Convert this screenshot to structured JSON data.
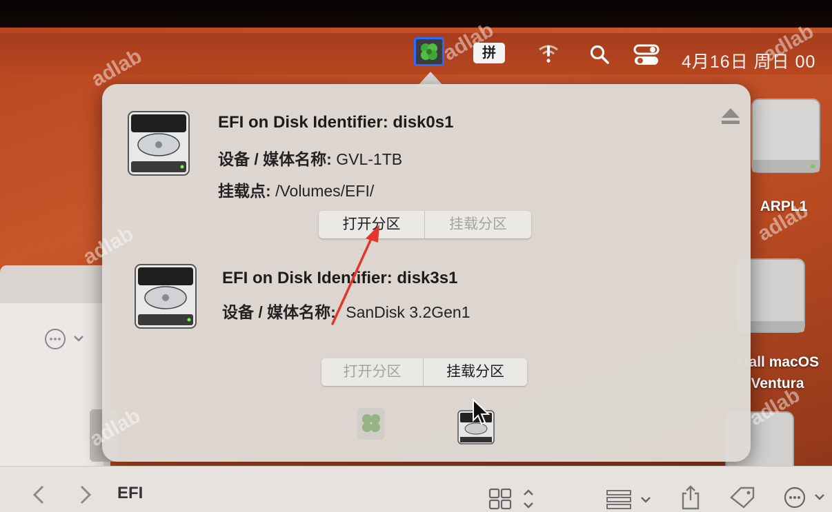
{
  "menubar": {
    "input_method": "拼",
    "clock": "4月16日 周日 00",
    "icons": [
      "clover-app-icon",
      "input-method-icon",
      "wifi-warning-icon",
      "search-icon",
      "control-center-icon"
    ]
  },
  "popover": {
    "disks": [
      {
        "title": "EFI on Disk Identifier: disk0s1",
        "device_label": "设备 / 媒体名称:",
        "device_value": "GVL-1TB",
        "mount_label": "挂载点:",
        "mount_value": "/Volumes/EFI/",
        "open_button": "打开分区",
        "mount_button": "挂载分区",
        "open_enabled": true,
        "mount_enabled": false
      },
      {
        "title": "EFI on Disk Identifier: disk3s1",
        "device_label": "设备 / 媒体名称:",
        "device_value": "SanDisk 3.2Gen1",
        "open_button": "打开分区",
        "mount_button": "挂载分区",
        "open_enabled": false,
        "mount_enabled": true
      }
    ]
  },
  "desktop": {
    "drives": [
      {
        "label": "ARPL1"
      },
      {
        "label": "stall macOS\nVentura"
      }
    ]
  },
  "finder": {
    "title": "EFI"
  },
  "watermark": "adlab",
  "colors": {
    "desktop_orange": "#c9552a",
    "popover_bg": "#dedbd6",
    "annotation_arrow": "#e5342a",
    "selection_blue": "#2d6bff"
  }
}
